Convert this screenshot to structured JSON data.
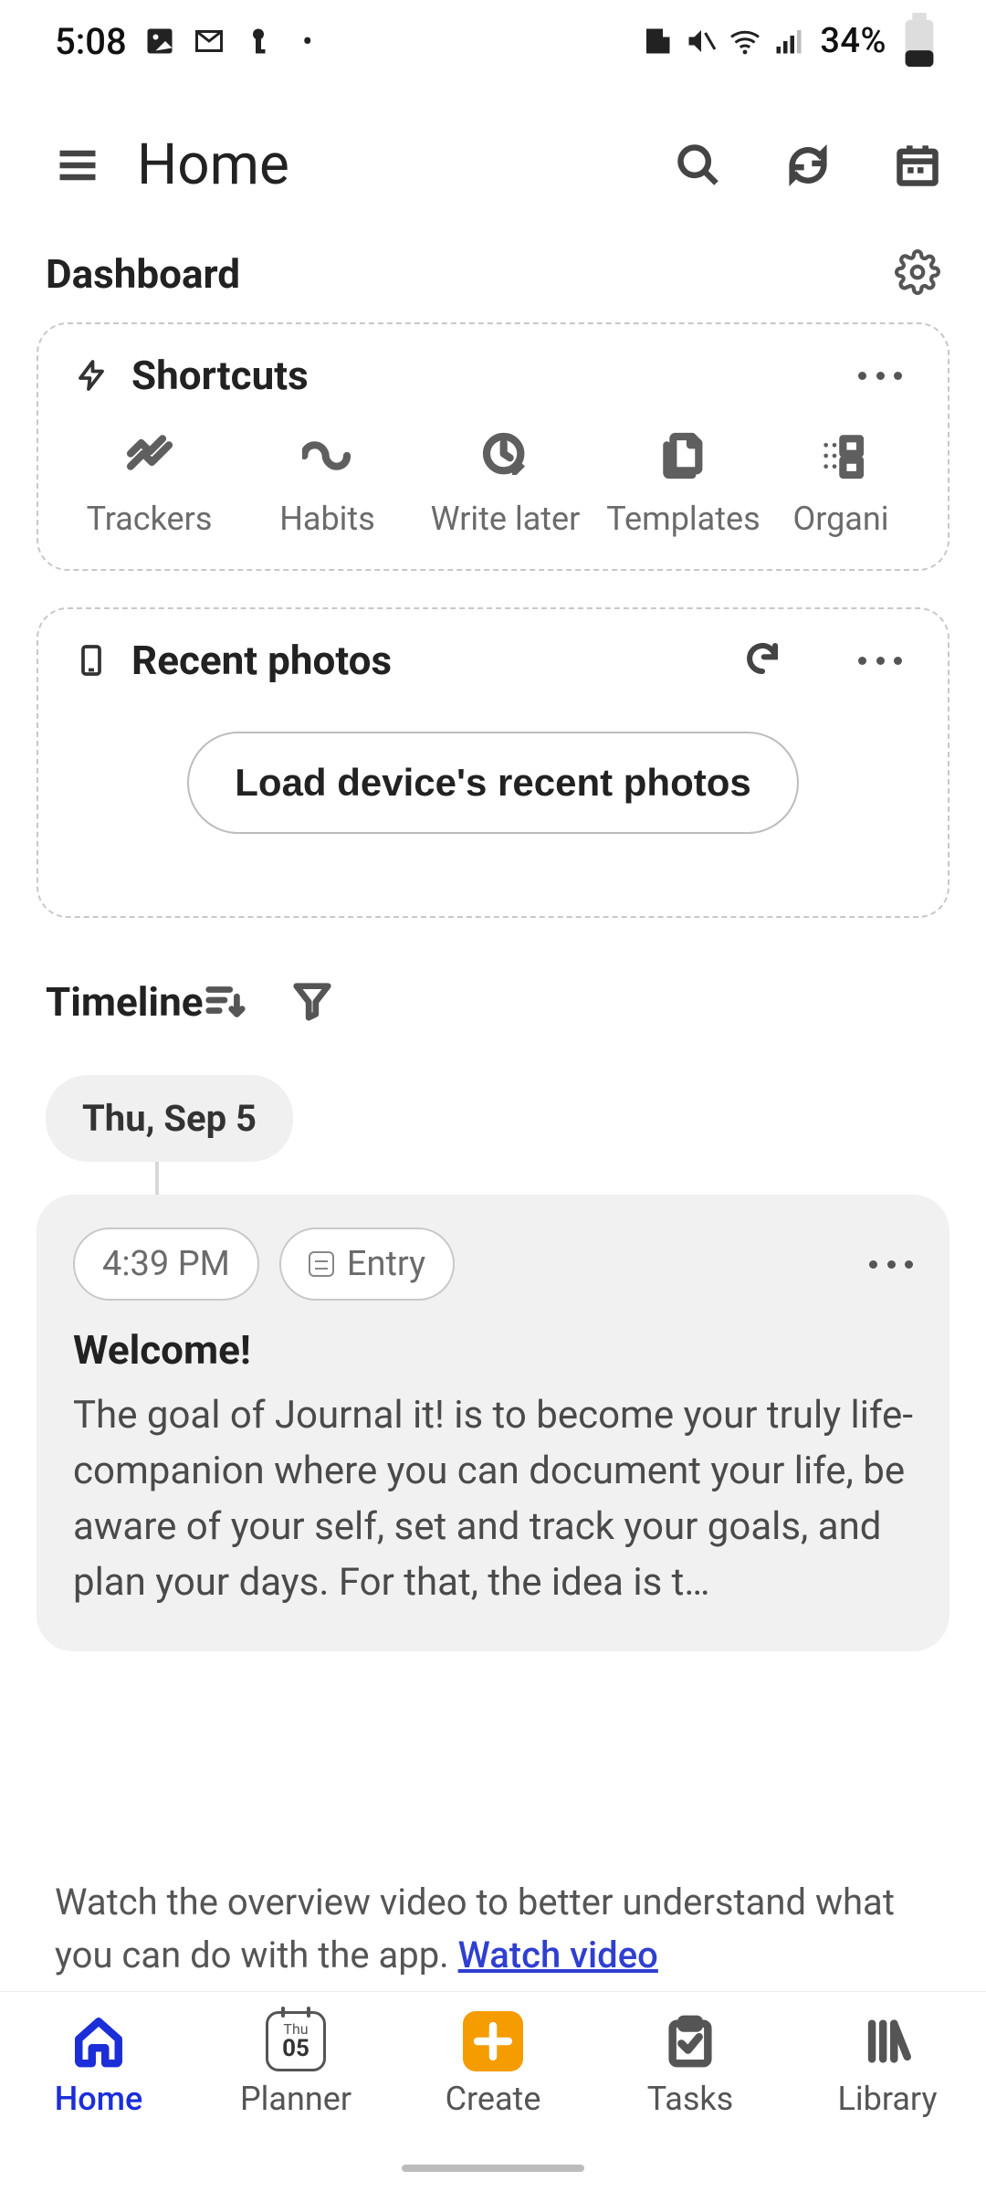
{
  "status": {
    "time": "5:08",
    "battery": "34%"
  },
  "appbar": {
    "title": "Home"
  },
  "dashboard": {
    "title": "Dashboard"
  },
  "shortcuts": {
    "title": "Shortcuts",
    "items": [
      {
        "label": "Trackers"
      },
      {
        "label": "Habits"
      },
      {
        "label": "Write later"
      },
      {
        "label": "Templates"
      },
      {
        "label": "Organi"
      }
    ]
  },
  "photos": {
    "title": "Recent photos",
    "button": "Load device's recent photos"
  },
  "timeline": {
    "title": "Timeline",
    "date": "Thu, Sep 5",
    "entry": {
      "time": "4:39 PM",
      "type": "Entry",
      "title": "Welcome!",
      "body": "The goal of Journal it! is to become your truly life-companion where you can document your life, be aware of your self, set and track your goals, and plan your days. For that, the idea is t…"
    }
  },
  "overview": {
    "text": "Watch the overview video to better understand what you can do with the app. ",
    "link": "Watch video"
  },
  "nav": {
    "home": "Home",
    "planner": "Planner",
    "planner_dow": "Thu",
    "planner_day": "05",
    "create": "Create",
    "tasks": "Tasks",
    "library": "Library"
  }
}
